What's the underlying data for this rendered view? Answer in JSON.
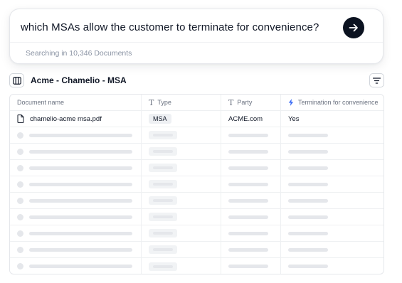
{
  "search": {
    "query": "which MSAs allow the customer to terminate for convenience?",
    "status": "Searching in 10,346 Documents",
    "send_icon": "arrow-right-icon"
  },
  "header": {
    "title": "Acme - Chamelio - MSA",
    "panel_icon": "sidebar-panel-icon",
    "filter_icon": "filter-icon"
  },
  "table": {
    "columns": [
      {
        "label": "Document name",
        "icon": ""
      },
      {
        "label": "Type",
        "icon": "text-type-icon"
      },
      {
        "label": "Party",
        "icon": "text-type-icon"
      },
      {
        "label": "Termination for convenience",
        "icon": "lightning-icon"
      }
    ],
    "rows": [
      {
        "name": "chamelio-acme msa.pdf",
        "type": "MSA",
        "party": "ACME.com",
        "termination": "Yes"
      }
    ],
    "loading_rows": 9
  },
  "colors": {
    "accent": "#3b6cf6",
    "send_button": "#0b1220"
  }
}
